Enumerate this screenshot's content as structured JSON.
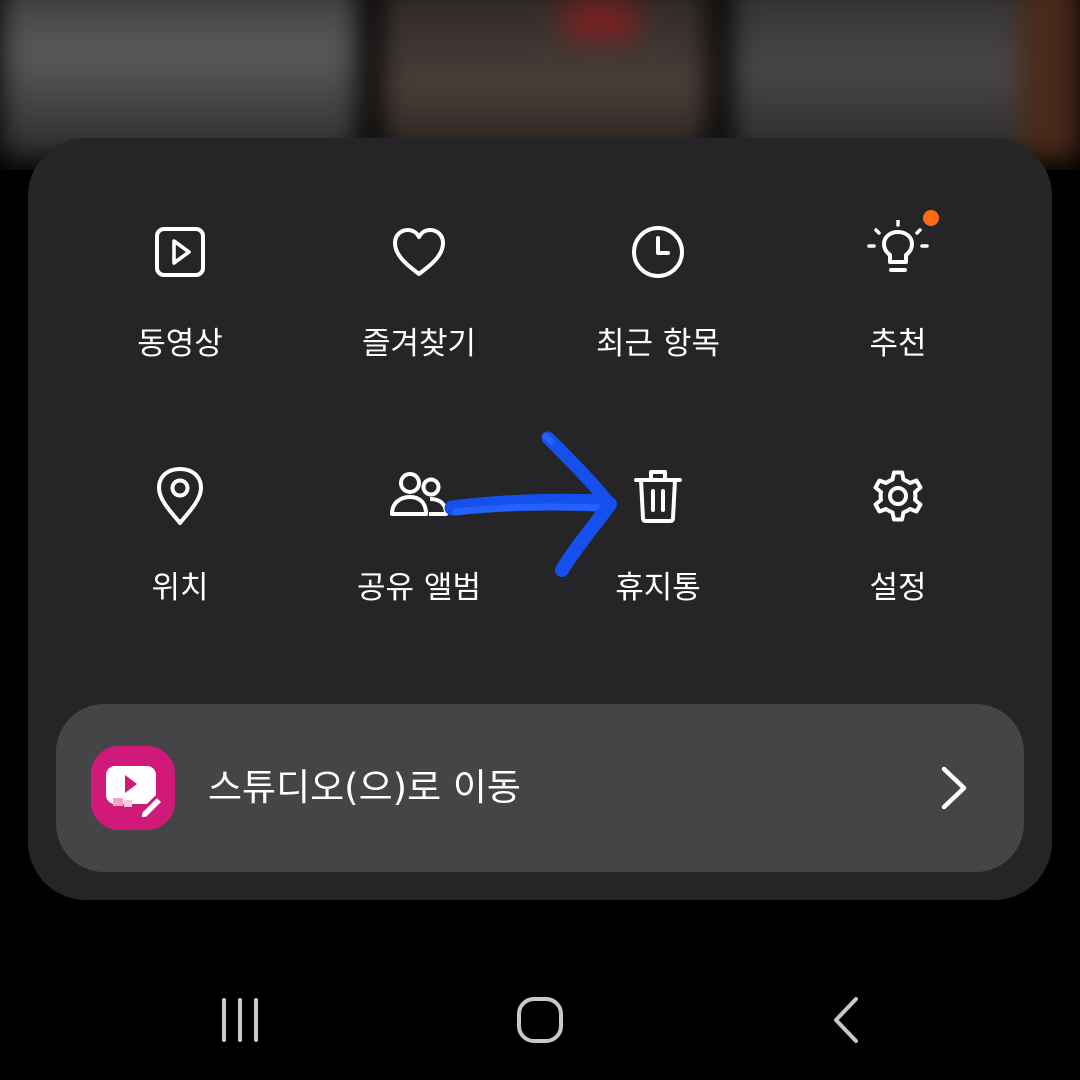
{
  "colors": {
    "sheet_bg": "#252527",
    "studio_bar_bg": "#454548",
    "badge": "#ff6a13",
    "studio_logo": "#d1197a",
    "annotation_arrow": "#1550ee",
    "icon": "#ffffff"
  },
  "menu": {
    "items": [
      {
        "label": "동영상",
        "icon": "video-icon"
      },
      {
        "label": "즐겨찾기",
        "icon": "heart-icon"
      },
      {
        "label": "최근 항목",
        "icon": "clock-icon"
      },
      {
        "label": "추천",
        "icon": "lightbulb-icon",
        "has_badge": true
      },
      {
        "label": "위치",
        "icon": "location-pin-icon"
      },
      {
        "label": "공유 앨범",
        "icon": "people-icon"
      },
      {
        "label": "휴지통",
        "icon": "trash-icon"
      },
      {
        "label": "설정",
        "icon": "gear-icon"
      }
    ]
  },
  "studio": {
    "label": "스튜디오(으)로 이동",
    "icon": "studio-app-icon",
    "chevron_icon": "chevron-right-icon"
  },
  "navbar": {
    "recents_icon": "recent-apps-icon",
    "home_icon": "home-icon",
    "back_icon": "back-icon"
  },
  "annotation": {
    "icon": "hand-drawn-arrow-icon"
  }
}
